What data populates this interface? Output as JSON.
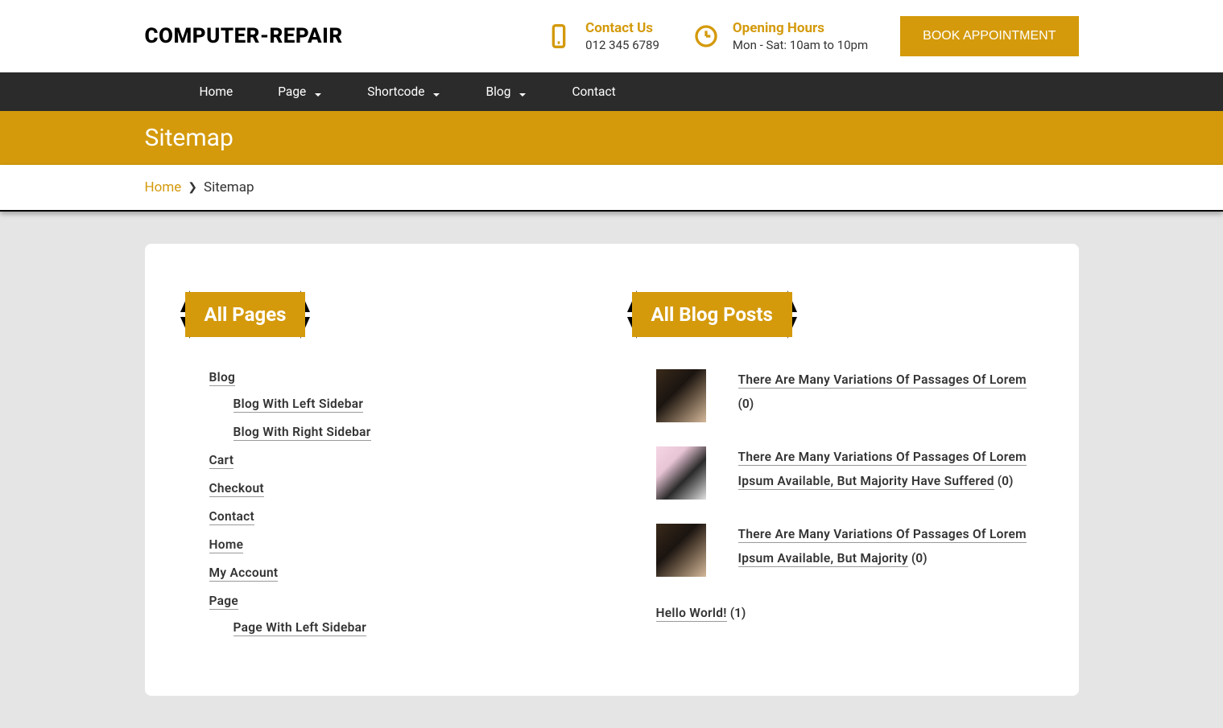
{
  "site": {
    "logo": "COMPUTER-REPAIR"
  },
  "header": {
    "contact": {
      "title": "Contact Us",
      "detail": "012 345 6789"
    },
    "hours": {
      "title": "Opening Hours",
      "detail": "Mon - Sat: 10am to 10pm"
    },
    "button": "BOOK APPOINTMENT"
  },
  "nav": {
    "items": [
      {
        "label": "Home",
        "dropdown": false
      },
      {
        "label": "Page",
        "dropdown": true
      },
      {
        "label": "Shortcode",
        "dropdown": true
      },
      {
        "label": "Blog",
        "dropdown": true
      },
      {
        "label": "Contact",
        "dropdown": false
      }
    ]
  },
  "page": {
    "title": "Sitemap"
  },
  "breadcrumb": {
    "home": "Home",
    "current": "Sitemap"
  },
  "sections": {
    "pages": {
      "title": "All Pages",
      "items": {
        "blog": "Blog",
        "blog_left": "Blog With Left Sidebar",
        "blog_right": "Blog With Right Sidebar",
        "cart": "Cart",
        "checkout": "Checkout",
        "contact": "Contact",
        "home": "Home",
        "account": "My Account",
        "page": "Page",
        "page_left": "Page With Left Sidebar"
      }
    },
    "posts": {
      "title": "All Blog Posts",
      "items": [
        {
          "title": "There Are Many Variations Of Passages Of Lorem",
          "count": "(0)"
        },
        {
          "title": "There Are Many Variations Of Passages Of Lorem Ipsum Available, But Majority Have Suffered",
          "count": "(0)"
        },
        {
          "title": "There Are Many Variations Of Passages Of Lorem Ipsum Available, But Majority",
          "count": "(0)"
        },
        {
          "title": "Hello World!",
          "count": "(1)"
        }
      ]
    }
  }
}
